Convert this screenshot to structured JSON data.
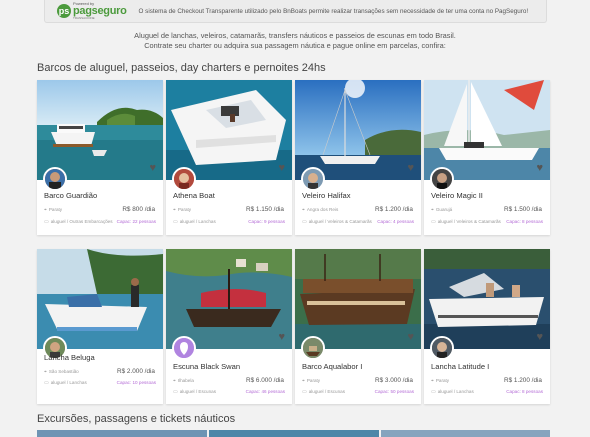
{
  "banner": {
    "logo_powered": "Powered by",
    "logo_name": "pagseguro",
    "logo_sub": "TRANSACIONE",
    "text": "O sistema de Checkout Transparente utilizado pelo BnBoats permite realizar transações sem necessidade de ter uma conta no PagSeguro!"
  },
  "intro": {
    "line1": "Aluguel de lanchas, veleiros, catamarãs, transfers náuticos e passeios de escunas em todo Brasil.",
    "line2": "Contrate seu charter ou adquira sua passagem náutica e pague online em parcelas, confira:"
  },
  "sections": {
    "boats_title": "Barcos de aluguel, passeios, day charters e pernoites 24hs",
    "excursions_title": "Excursões, passagens e tickets náuticos"
  },
  "listings": [
    {
      "title": "Barco Guardião",
      "location": "Paraty",
      "price": "R$ 800 /dia",
      "category": "aluguel / Outras Embarcações",
      "capacity": "Capac: 22 pessoas"
    },
    {
      "title": "Athena Boat",
      "location": "Paraty",
      "price": "R$ 1.150 /dia",
      "category": "aluguel / Lanchas",
      "capacity": "Capac: 9 pessoas"
    },
    {
      "title": "Veleiro Halifax",
      "location": "Angra dos Reis",
      "price": "R$ 1.200 /dia",
      "category": "aluguel / Veleiros & Catamarãs",
      "capacity": "Capac: 4 pessoas"
    },
    {
      "title": "Veleiro Magic II",
      "location": "Guarujá",
      "price": "R$ 1.500 /dia",
      "category": "aluguel / Veleiros & Catamarãs",
      "capacity": "Capac: 8 pessoas"
    },
    {
      "title": "Lancha Beluga",
      "location": "São Sebastião",
      "price": "R$ 2.000 /dia",
      "category": "aluguel / Lanchas",
      "capacity": "Capac: 10 pessoas"
    },
    {
      "title": "Escuna Black Swan",
      "location": "Ilhabela",
      "price": "R$ 6.000 /dia",
      "category": "aluguel / Escunas",
      "capacity": "Capac: 46 pessoas"
    },
    {
      "title": "Barco Aqualabor I",
      "location": "Paraty",
      "price": "R$ 3.000 /dia",
      "category": "aluguel / Escunas",
      "capacity": "Capac: 50 pessoas"
    },
    {
      "title": "Lancha Latitude I",
      "location": "Paraty",
      "price": "R$ 1.200 /dia",
      "category": "aluguel / Lanchas",
      "capacity": "Capac: 8 pessoas"
    }
  ],
  "icons": {
    "location": "map-pin-icon",
    "category": "folder-icon",
    "favorite": "heart-icon"
  },
  "colors": {
    "pagseguro_green": "#4b9a3c",
    "capacity_purple": "#b46cd6",
    "page_bg": "#f2f2f2"
  }
}
